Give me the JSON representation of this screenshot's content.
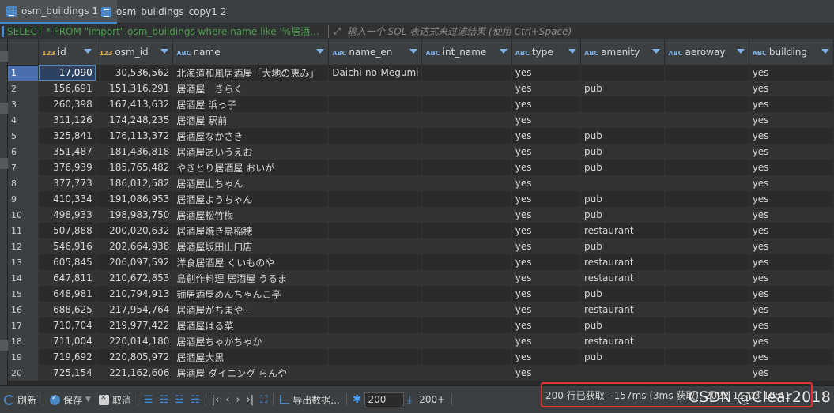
{
  "tabs": [
    {
      "label": "osm_buildings 1",
      "active": true
    },
    {
      "label": "osm_buildings_copy1 2",
      "active": false
    }
  ],
  "filter": {
    "sql": "SELECT * FROM \"import\".osm_buildings where name like '%居酒屋%'",
    "hint": "输入一个 SQL 表达式来过滤结果 (使用 Ctrl+Space)"
  },
  "columns": [
    {
      "label": "id",
      "type": "123",
      "key": true
    },
    {
      "label": "osm_id",
      "type": "123",
      "key": true
    },
    {
      "label": "name",
      "type": "ABC"
    },
    {
      "label": "name_en",
      "type": "ABC"
    },
    {
      "label": "int_name",
      "type": "ABC"
    },
    {
      "label": "type",
      "type": "ABC"
    },
    {
      "label": "amenity",
      "type": "ABC"
    },
    {
      "label": "aeroway",
      "type": "ABC"
    },
    {
      "label": "building",
      "type": "ABC"
    }
  ],
  "rows": [
    {
      "n": "1",
      "id": "17,090",
      "osm_id": "30,536,562",
      "name": "北海道和風居酒屋「大地の恵み」",
      "name_en": "Daichi-no-Megumi",
      "int_name": "",
      "type": "yes",
      "amenity": "",
      "aeroway": "",
      "building": "yes"
    },
    {
      "n": "2",
      "id": "156,691",
      "osm_id": "151,316,291",
      "name": "居酒屋　きらく",
      "name_en": "",
      "int_name": "",
      "type": "yes",
      "amenity": "pub",
      "aeroway": "",
      "building": "yes"
    },
    {
      "n": "3",
      "id": "260,398",
      "osm_id": "167,413,632",
      "name": "居酒屋 浜っ子",
      "name_en": "",
      "int_name": "",
      "type": "yes",
      "amenity": "",
      "aeroway": "",
      "building": "yes"
    },
    {
      "n": "4",
      "id": "311,126",
      "osm_id": "174,248,235",
      "name": "居酒屋 駅前",
      "name_en": "",
      "int_name": "",
      "type": "yes",
      "amenity": "",
      "aeroway": "",
      "building": "yes"
    },
    {
      "n": "5",
      "id": "325,841",
      "osm_id": "176,113,372",
      "name": "居酒屋なかさき",
      "name_en": "",
      "int_name": "",
      "type": "yes",
      "amenity": "pub",
      "aeroway": "",
      "building": "yes"
    },
    {
      "n": "6",
      "id": "351,487",
      "osm_id": "181,436,818",
      "name": "居酒屋あいうえお",
      "name_en": "",
      "int_name": "",
      "type": "yes",
      "amenity": "pub",
      "aeroway": "",
      "building": "yes"
    },
    {
      "n": "7",
      "id": "376,939",
      "osm_id": "185,765,482",
      "name": "やきとり居酒屋 おいが",
      "name_en": "",
      "int_name": "",
      "type": "yes",
      "amenity": "pub",
      "aeroway": "",
      "building": "yes"
    },
    {
      "n": "8",
      "id": "377,773",
      "osm_id": "186,012,582",
      "name": "居酒屋山ちゃん",
      "name_en": "",
      "int_name": "",
      "type": "yes",
      "amenity": "",
      "aeroway": "",
      "building": "yes"
    },
    {
      "n": "9",
      "id": "410,334",
      "osm_id": "191,086,953",
      "name": "居酒屋ようちゃん",
      "name_en": "",
      "int_name": "",
      "type": "yes",
      "amenity": "pub",
      "aeroway": "",
      "building": "yes"
    },
    {
      "n": "10",
      "id": "498,933",
      "osm_id": "198,983,750",
      "name": "居酒屋松竹梅",
      "name_en": "",
      "int_name": "",
      "type": "yes",
      "amenity": "pub",
      "aeroway": "",
      "building": "yes"
    },
    {
      "n": "11",
      "id": "507,888",
      "osm_id": "200,020,632",
      "name": "居酒屋焼き鳥稲穂",
      "name_en": "",
      "int_name": "",
      "type": "yes",
      "amenity": "restaurant",
      "aeroway": "",
      "building": "yes"
    },
    {
      "n": "12",
      "id": "546,916",
      "osm_id": "202,664,938",
      "name": "居酒屋坂田山口店",
      "name_en": "",
      "int_name": "",
      "type": "yes",
      "amenity": "pub",
      "aeroway": "",
      "building": "yes"
    },
    {
      "n": "13",
      "id": "605,845",
      "osm_id": "206,097,592",
      "name": "洋食居酒屋 くいものや",
      "name_en": "",
      "int_name": "",
      "type": "yes",
      "amenity": "restaurant",
      "aeroway": "",
      "building": "yes"
    },
    {
      "n": "14",
      "id": "647,811",
      "osm_id": "210,672,853",
      "name": "島創作料理 居酒屋 うるま",
      "name_en": "",
      "int_name": "",
      "type": "yes",
      "amenity": "restaurant",
      "aeroway": "",
      "building": "yes"
    },
    {
      "n": "15",
      "id": "648,981",
      "osm_id": "210,794,913",
      "name": "麺居酒屋めんちゃんこ亭",
      "name_en": "",
      "int_name": "",
      "type": "yes",
      "amenity": "pub",
      "aeroway": "",
      "building": "yes"
    },
    {
      "n": "16",
      "id": "688,625",
      "osm_id": "217,954,764",
      "name": "居酒屋がちまやー",
      "name_en": "",
      "int_name": "",
      "type": "yes",
      "amenity": "restaurant",
      "aeroway": "",
      "building": "yes"
    },
    {
      "n": "17",
      "id": "710,704",
      "osm_id": "219,977,422",
      "name": "居酒屋はる菜",
      "name_en": "",
      "int_name": "",
      "type": "yes",
      "amenity": "pub",
      "aeroway": "",
      "building": "yes"
    },
    {
      "n": "18",
      "id": "711,004",
      "osm_id": "220,014,180",
      "name": "居酒屋ちゃかちゃか",
      "name_en": "",
      "int_name": "",
      "type": "yes",
      "amenity": "restaurant",
      "aeroway": "",
      "building": "yes"
    },
    {
      "n": "19",
      "id": "719,692",
      "osm_id": "220,805,972",
      "name": "居酒屋大黒",
      "name_en": "",
      "int_name": "",
      "type": "yes",
      "amenity": "pub",
      "aeroway": "",
      "building": "yes"
    },
    {
      "n": "20",
      "id": "725,154",
      "osm_id": "221,162,606",
      "name": "居酒屋 ダイニング らんや",
      "name_en": "",
      "int_name": "",
      "type": "yes",
      "amenity": "",
      "aeroway": "",
      "building": "yes"
    }
  ],
  "bottom": {
    "refresh": "刷新",
    "save": "保存",
    "cancel": "取消",
    "export": "导出数据...",
    "fetch_size": "200",
    "fetch_more": "200+",
    "status": "200 行已获取 - 157ms (3ms 获取), 2022-11-03 10:41"
  },
  "watermark": "CSDN @Clear2018"
}
